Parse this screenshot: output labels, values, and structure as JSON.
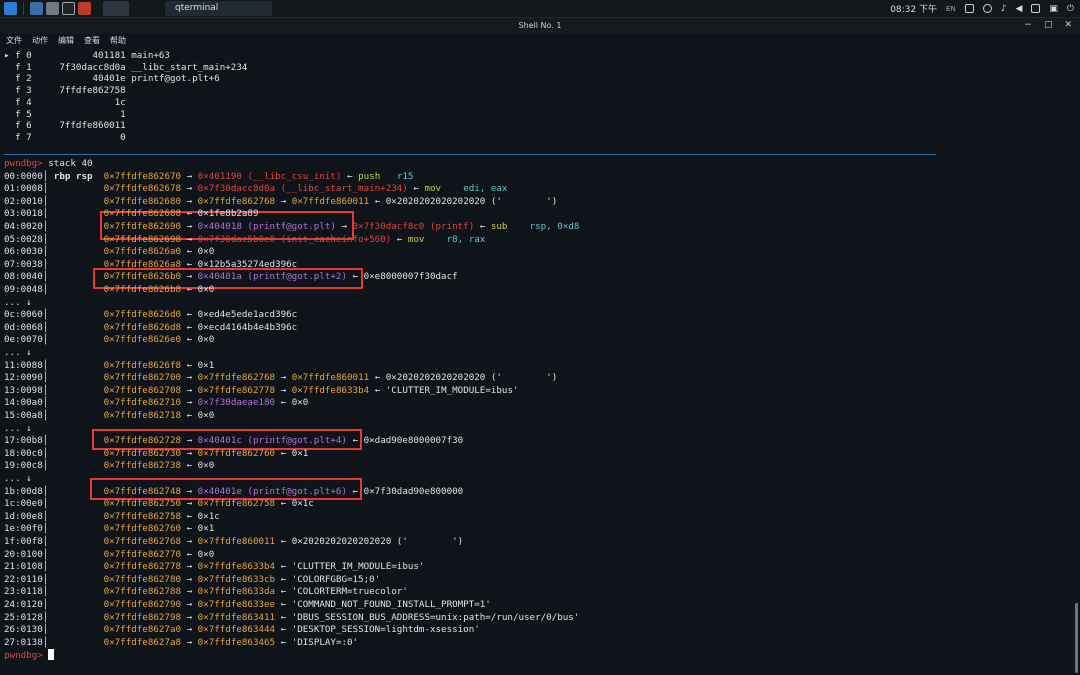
{
  "taskbar": {
    "app_title": "qterminal",
    "clock": "08:32 下午",
    "lang": "EN"
  },
  "window": {
    "title": "Shell No. 1",
    "controls": [
      "−",
      "▢",
      "✕"
    ]
  },
  "menu": [
    "文件",
    "动作",
    "编辑",
    "查看",
    "帮助"
  ],
  "colors": {
    "background": "#0f141a",
    "address": "#e8a33c",
    "code": "#e0453a",
    "symbol": "#b56fd6",
    "prompt": "#e0453a",
    "highlight_box": "#e53935"
  },
  "lines": [
    [
      [
        "wh",
        "▸ f 0           401181 main+63"
      ]
    ],
    [
      [
        "wh",
        "  f 1     7f30dacc8d0a __libc_start_main+234"
      ]
    ],
    [
      [
        "wh",
        "  f 2           40401e printf@got.plt+6"
      ]
    ],
    [
      [
        "wh",
        "  f 3     7ffdfe862758"
      ]
    ],
    [
      [
        "wh",
        "  f 4               1c"
      ]
    ],
    [
      [
        "wh",
        "  f 5                1"
      ]
    ],
    [
      [
        "wh",
        "  f 6     7ffdfe860011"
      ]
    ],
    [
      [
        "wh",
        "  f 7                0"
      ]
    ],
    [
      [
        "wh",
        ""
      ]
    ],
    [
      [
        "rd",
        "pwndbg> "
      ],
      [
        "wh",
        "stack 40"
      ]
    ],
    [
      [
        "wh",
        "00:0000│ "
      ],
      [
        "wh",
        "rbp rsp  "
      ],
      [
        "or",
        "0×7ffdfe862670"
      ],
      [
        "wh",
        " → "
      ],
      [
        "rd",
        "0×401190 (__libc_csu_init)"
      ],
      [
        "wh",
        " ← "
      ],
      [
        "yl",
        "push"
      ],
      [
        "wh",
        "   "
      ],
      [
        "cy",
        "r15"
      ]
    ],
    [
      [
        "wh",
        "01:0008│          "
      ],
      [
        "or",
        "0×7ffdfe862678"
      ],
      [
        "wh",
        " → "
      ],
      [
        "rd",
        "0×7f30dacc8d0a (__libc_start_main+234)"
      ],
      [
        "wh",
        " ← "
      ],
      [
        "yl",
        "mov"
      ],
      [
        "wh",
        "    "
      ],
      [
        "cy",
        "edi, eax"
      ]
    ],
    [
      [
        "wh",
        "02:0010│          "
      ],
      [
        "or",
        "0×7ffdfe862680"
      ],
      [
        "wh",
        " → "
      ],
      [
        "or",
        "0×7ffdfe862768"
      ],
      [
        "wh",
        " → "
      ],
      [
        "or",
        "0×7ffdfe860011"
      ],
      [
        "wh",
        " ← 0×2020202020202020 ('        ')"
      ]
    ],
    [
      [
        "wh",
        "03:0018│          "
      ],
      [
        "or",
        "0×7ffdfe862688"
      ],
      [
        "wh",
        " ← 0×1fe8b2a89"
      ]
    ],
    [
      [
        "wh",
        "04:0020│          "
      ],
      [
        "or",
        "0×7ffdfe862690"
      ],
      [
        "wh",
        " → "
      ],
      [
        "pu",
        "0×404018 (printf@got.plt)"
      ],
      [
        "wh",
        " → "
      ],
      [
        "rd",
        "0×7f30dacf8c0 (printf)"
      ],
      [
        "wh",
        " ← "
      ],
      [
        "yl",
        "sub"
      ],
      [
        "wh",
        "    "
      ],
      [
        "cy",
        "rsp, 0×d8"
      ]
    ],
    [
      [
        "wh",
        "05:0028│          "
      ],
      [
        "or",
        "0×7ffdfe862698"
      ],
      [
        "wh",
        " → "
      ],
      [
        "rd",
        "0×7f30dac5b0e0 (init_cacheinfo+560)"
      ],
      [
        "wh",
        " ← "
      ],
      [
        "yl",
        "mov"
      ],
      [
        "wh",
        "    "
      ],
      [
        "cy",
        "r8, rax"
      ]
    ],
    [
      [
        "wh",
        "06:0030│          "
      ],
      [
        "or",
        "0×7ffdfe8626a0"
      ],
      [
        "wh",
        " ← 0×0"
      ]
    ],
    [
      [
        "wh",
        "07:0038│          "
      ],
      [
        "or",
        "0×7ffdfe8626a8"
      ],
      [
        "wh",
        " ← 0×12b5a35274ed396c"
      ]
    ],
    [
      [
        "wh",
        "08:0040│          "
      ],
      [
        "or",
        "0×7ffdfe8626b0"
      ],
      [
        "wh",
        " → "
      ],
      [
        "pu",
        "0×40401a (printf@got.plt+2)"
      ],
      [
        "wh",
        " ← 0×e8000007f30dacf"
      ]
    ],
    [
      [
        "wh",
        "09:0048│          "
      ],
      [
        "or",
        "0×7ffdfe8626b8"
      ],
      [
        "wh",
        " ← 0×0"
      ]
    ],
    [
      [
        "wh",
        "... ↓"
      ]
    ],
    [
      [
        "wh",
        "0c:0060│          "
      ],
      [
        "or",
        "0×7ffdfe8626d0"
      ],
      [
        "wh",
        " ← 0×ed4e5ede1acd396c"
      ]
    ],
    [
      [
        "wh",
        "0d:0068│          "
      ],
      [
        "or",
        "0×7ffdfe8626d8"
      ],
      [
        "wh",
        " ← 0×ecd4164b4e4b396c"
      ]
    ],
    [
      [
        "wh",
        "0e:0070│          "
      ],
      [
        "or",
        "0×7ffdfe8626e0"
      ],
      [
        "wh",
        " ← 0×0"
      ]
    ],
    [
      [
        "wh",
        "... ↓"
      ]
    ],
    [
      [
        "wh",
        "11:0088│          "
      ],
      [
        "or",
        "0×7ffdfe8626f8"
      ],
      [
        "wh",
        " ← 0×1"
      ]
    ],
    [
      [
        "wh",
        "12:0090│          "
      ],
      [
        "or",
        "0×7ffdfe862700"
      ],
      [
        "wh",
        " → "
      ],
      [
        "or",
        "0×7ffdfe862768"
      ],
      [
        "wh",
        " → "
      ],
      [
        "or",
        "0×7ffdfe860011"
      ],
      [
        "wh",
        " ← 0×2020202020202020 ('        ')"
      ]
    ],
    [
      [
        "wh",
        "13:0098│          "
      ],
      [
        "or",
        "0×7ffdfe862708"
      ],
      [
        "wh",
        " → "
      ],
      [
        "or",
        "0×7ffdfe862778"
      ],
      [
        "wh",
        " → "
      ],
      [
        "or",
        "0×7ffdfe8633b4"
      ],
      [
        "wh",
        " ← 'CLUTTER_IM_MODULE=ibus'"
      ]
    ],
    [
      [
        "wh",
        "14:00a0│          "
      ],
      [
        "or",
        "0×7ffdfe862710"
      ],
      [
        "wh",
        " → "
      ],
      [
        "pu",
        "0×7f30daeae180"
      ],
      [
        "wh",
        " ← 0×0"
      ]
    ],
    [
      [
        "wh",
        "15:00a8│          "
      ],
      [
        "or",
        "0×7ffdfe862718"
      ],
      [
        "wh",
        " ← 0×0"
      ]
    ],
    [
      [
        "wh",
        "... ↓"
      ]
    ],
    [
      [
        "wh",
        "17:00b8│          "
      ],
      [
        "or",
        "0×7ffdfe862728"
      ],
      [
        "wh",
        " → "
      ],
      [
        "pu",
        "0×40401c (printf@got.plt+4)"
      ],
      [
        "wh",
        " ← 0×dad90e8000007f30"
      ]
    ],
    [
      [
        "wh",
        "18:00c0│          "
      ],
      [
        "or",
        "0×7ffdfe862730"
      ],
      [
        "wh",
        " → "
      ],
      [
        "or",
        "0×7ffdfe862760"
      ],
      [
        "wh",
        " ← 0×1"
      ]
    ],
    [
      [
        "wh",
        "19:00c8│          "
      ],
      [
        "or",
        "0×7ffdfe862738"
      ],
      [
        "wh",
        " ← 0×0"
      ]
    ],
    [
      [
        "wh",
        "... ↓"
      ]
    ],
    [
      [
        "wh",
        "1b:00d8│          "
      ],
      [
        "or",
        "0×7ffdfe862748"
      ],
      [
        "wh",
        " → "
      ],
      [
        "pu",
        "0×40401e (printf@got.plt+6)"
      ],
      [
        "wh",
        " ← 0×7f30dad90e800000"
      ]
    ],
    [
      [
        "wh",
        "1c:00e0│          "
      ],
      [
        "or",
        "0×7ffdfe862750"
      ],
      [
        "wh",
        " → "
      ],
      [
        "or",
        "0×7ffdfe862758"
      ],
      [
        "wh",
        " ← 0×1c"
      ]
    ],
    [
      [
        "wh",
        "1d:00e8│          "
      ],
      [
        "or",
        "0×7ffdfe862758"
      ],
      [
        "wh",
        " ← 0×1c"
      ]
    ],
    [
      [
        "wh",
        "1e:00f0│          "
      ],
      [
        "or",
        "0×7ffdfe862760"
      ],
      [
        "wh",
        " ← 0×1"
      ]
    ],
    [
      [
        "wh",
        "1f:00f8│          "
      ],
      [
        "or",
        "0×7ffdfe862768"
      ],
      [
        "wh",
        " → "
      ],
      [
        "or",
        "0×7ffdfe860011"
      ],
      [
        "wh",
        " ← 0×2020202020202020 ('        ')"
      ]
    ],
    [
      [
        "wh",
        "20:0100│          "
      ],
      [
        "or",
        "0×7ffdfe862770"
      ],
      [
        "wh",
        " ← 0×0"
      ]
    ],
    [
      [
        "wh",
        "21:0108│          "
      ],
      [
        "or",
        "0×7ffdfe862778"
      ],
      [
        "wh",
        " → "
      ],
      [
        "or",
        "0×7ffdfe8633b4"
      ],
      [
        "wh",
        " ← 'CLUTTER_IM_MODULE=ibus'"
      ]
    ],
    [
      [
        "wh",
        "22:0110│          "
      ],
      [
        "or",
        "0×7ffdfe862780"
      ],
      [
        "wh",
        " → "
      ],
      [
        "or",
        "0×7ffdfe8633cb"
      ],
      [
        "wh",
        " ← 'COLORFGBG=15;0'"
      ]
    ],
    [
      [
        "wh",
        "23:0118│          "
      ],
      [
        "or",
        "0×7ffdfe862788"
      ],
      [
        "wh",
        " → "
      ],
      [
        "or",
        "0×7ffdfe8633da"
      ],
      [
        "wh",
        " ← 'COLORTERM=truecolor'"
      ]
    ],
    [
      [
        "wh",
        "24:0120│          "
      ],
      [
        "or",
        "0×7ffdfe862790"
      ],
      [
        "wh",
        " → "
      ],
      [
        "or",
        "0×7ffdfe8633ee"
      ],
      [
        "wh",
        " ← 'COMMAND_NOT_FOUND_INSTALL_PROMPT=1'"
      ]
    ],
    [
      [
        "wh",
        "25:0128│          "
      ],
      [
        "or",
        "0×7ffdfe862798"
      ],
      [
        "wh",
        " → "
      ],
      [
        "or",
        "0×7ffdfe863411"
      ],
      [
        "wh",
        " ← 'DBUS_SESSION_BUS_ADDRESS=unix:path=/run/user/0/bus'"
      ]
    ],
    [
      [
        "wh",
        "26:0130│          "
      ],
      [
        "or",
        "0×7ffdfe8627a0"
      ],
      [
        "wh",
        " → "
      ],
      [
        "or",
        "0×7ffdfe863444"
      ],
      [
        "wh",
        " ← 'DESKTOP_SESSION=lightdm-xsession'"
      ]
    ],
    [
      [
        "wh",
        "27:0138│          "
      ],
      [
        "or",
        "0×7ffdfe8627a8"
      ],
      [
        "wh",
        " → "
      ],
      [
        "or",
        "0×7ffdfe863465"
      ],
      [
        "wh",
        " ← 'DISPLAY=:0'"
      ]
    ],
    [
      [
        "rd",
        "pwndbg> "
      ]
    ]
  ]
}
